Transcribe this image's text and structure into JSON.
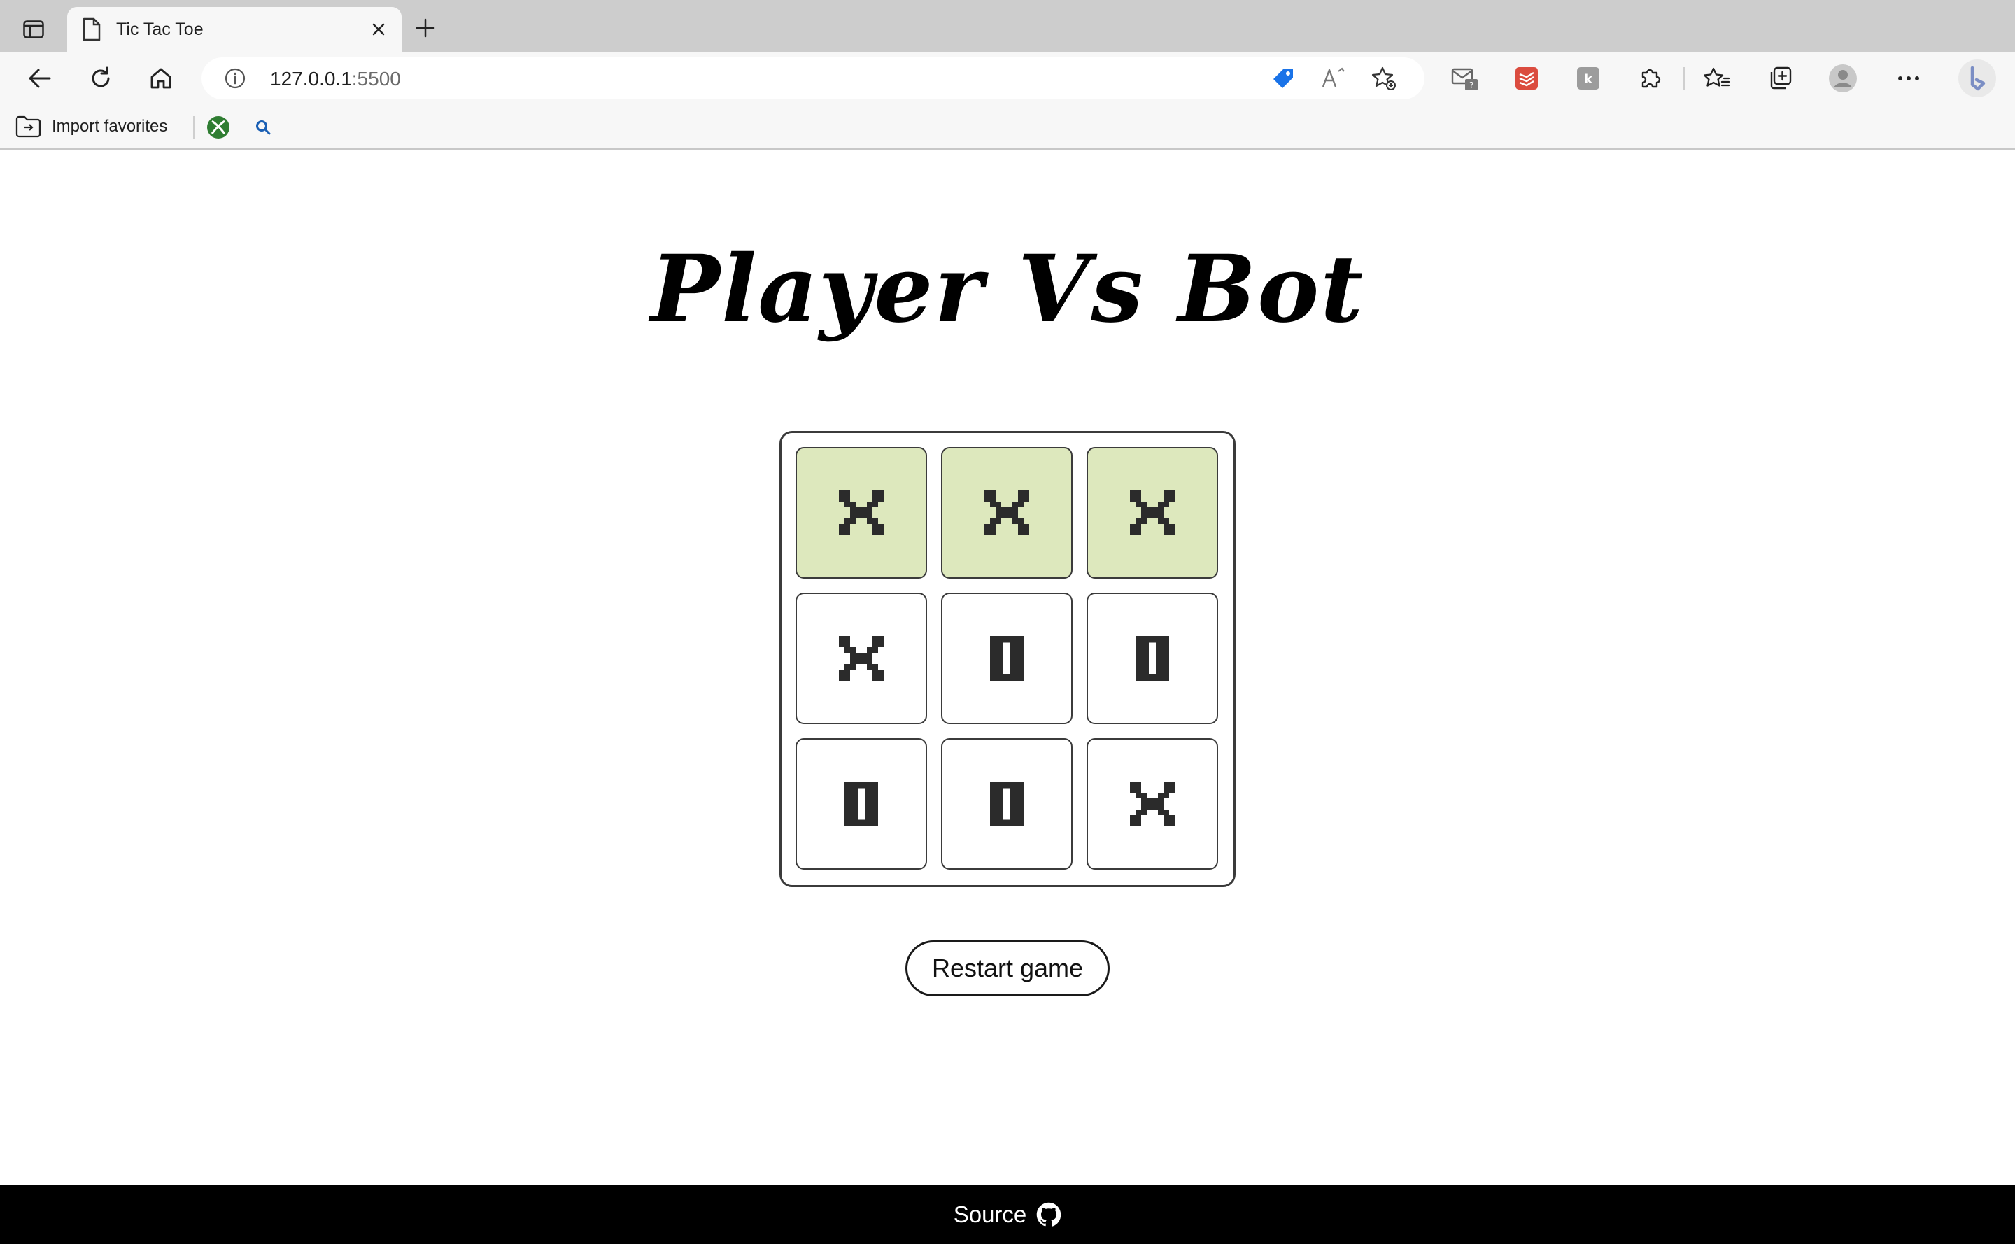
{
  "browser": {
    "tab": {
      "title": "Tic Tac Toe"
    },
    "address": {
      "host": "127.0.0.1",
      "port": ":5500"
    },
    "bookmarks": {
      "import_label": "Import favorites"
    }
  },
  "game": {
    "title": "Player Vs Bot",
    "board": [
      {
        "mark": "X",
        "winning": true
      },
      {
        "mark": "X",
        "winning": true
      },
      {
        "mark": "X",
        "winning": true
      },
      {
        "mark": "X",
        "winning": false
      },
      {
        "mark": "O",
        "winning": false
      },
      {
        "mark": "O",
        "winning": false
      },
      {
        "mark": "O",
        "winning": false
      },
      {
        "mark": "O",
        "winning": false
      },
      {
        "mark": "X",
        "winning": false
      }
    ],
    "restart_label": "Restart game",
    "win_color": "#dde8bd",
    "mark_color": "#2b2b2b"
  },
  "footer": {
    "source_label": "Source",
    "icon": "github-icon"
  }
}
